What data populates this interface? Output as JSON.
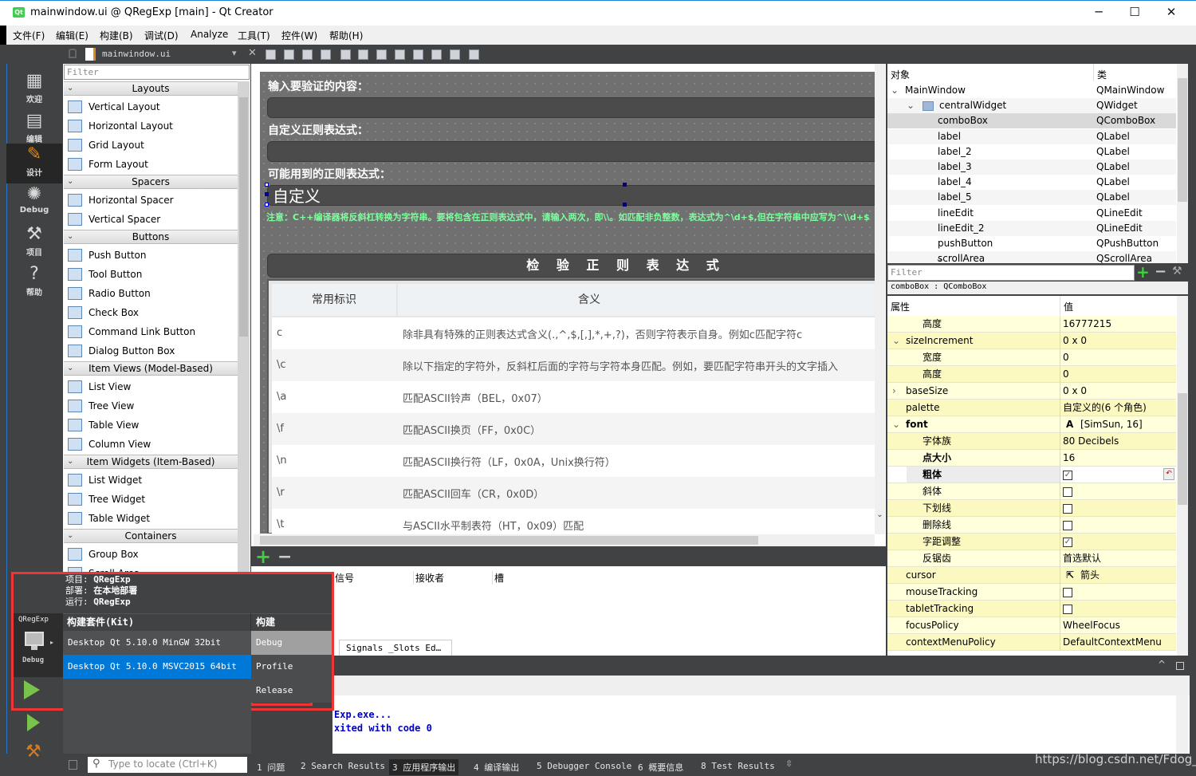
{
  "window": {
    "title": "mainwindow.ui @ QRegExp [main] - Qt Creator",
    "logo": "Qt",
    "minimize": "─",
    "maximize": "☐",
    "close": "✕"
  },
  "menu": [
    "文件(F)",
    "编辑(E)",
    "构建(B)",
    "调试(D)",
    "Analyze",
    "工具(T)",
    "控件(W)",
    "帮助(H)"
  ],
  "editor_toolbar": {
    "file": "mainwindow.ui",
    "dropdown": "▾",
    "close": "✕"
  },
  "modes": [
    {
      "label": "欢迎",
      "icon": "grid-icon",
      "glyph": "▦"
    },
    {
      "label": "编辑",
      "icon": "document-icon",
      "glyph": "▤"
    },
    {
      "label": "设计",
      "icon": "pencil-icon",
      "glyph": "✎",
      "selected": true
    },
    {
      "label": "Debug",
      "icon": "bug-icon",
      "glyph": "✺"
    },
    {
      "label": "项目",
      "icon": "wrench-icon",
      "glyph": "⚒"
    },
    {
      "label": "帮助",
      "icon": "help-icon",
      "glyph": "?"
    }
  ],
  "widget_box": {
    "filter_placeholder": "Filter",
    "sections": [
      {
        "title": "Layouts",
        "items": [
          "Vertical Layout",
          "Horizontal Layout",
          "Grid Layout",
          "Form Layout"
        ]
      },
      {
        "title": "Spacers",
        "items": [
          "Horizontal Spacer",
          "Vertical Spacer"
        ]
      },
      {
        "title": "Buttons",
        "items": [
          "Push Button",
          "Tool Button",
          "Radio Button",
          "Check Box",
          "Command Link Button",
          "Dialog Button Box"
        ]
      },
      {
        "title": "Item Views (Model-Based)",
        "items": [
          "List View",
          "Tree View",
          "Table View",
          "Column View"
        ]
      },
      {
        "title": "Item Widgets (Item-Based)",
        "items": [
          "List Widget",
          "Tree Widget",
          "Table Widget"
        ]
      },
      {
        "title": "Containers",
        "items": [
          "Group Box",
          "Scroll Area"
        ]
      }
    ]
  },
  "form": {
    "label_input": "输入要验证的内容：",
    "label_custom": "自定义正则表达式：",
    "label_possible": "可能用到的正则表达式：",
    "combo_value": "自定义",
    "note": "注意：C++编译器将反斜杠转换为字符串。要将包含在正则表达式中，请输入两次，即\\\\。如匹配非负整数，表达式为^\\d+$,但在字符串中应写为^\\\\d+$",
    "check_button": "检 验 正 则 表 达 式",
    "table": {
      "headers": [
        "常用标识",
        "含义"
      ],
      "rows": [
        [
          "c",
          "除非具有特殊的正则表达式含义(.,^,$,[,],*,+,?)，否则字符表示自身。例如c匹配字符c"
        ],
        [
          "\\c",
          "除以下指定的字符外，反斜杠后面的字符与字符本身匹配。例如，要匹配字符串开头的文字插入"
        ],
        [
          "\\a",
          "匹配ASCII铃声（BEL，0x07）"
        ],
        [
          "\\f",
          "匹配ASCII换页（FF，0x0C）"
        ],
        [
          "\\n",
          "匹配ASCII换行符（LF，0x0A，Unix换行符）"
        ],
        [
          "\\r",
          "匹配ASCII回车（CR，0x0D）"
        ],
        [
          "\\t",
          "与ASCII水平制表符（HT，0x09）匹配"
        ]
      ]
    }
  },
  "signal_slot": {
    "headers": [
      "信号",
      "接收者",
      "槽"
    ],
    "tab": "Signals _Slots Ed…",
    "add": "+",
    "remove": "−"
  },
  "object_inspector": {
    "headers": [
      "对象",
      "类"
    ],
    "rows": [
      {
        "name": "MainWindow",
        "class": "QMainWindow",
        "level": 0,
        "expand": "⌄"
      },
      {
        "name": "centralWidget",
        "class": "QWidget",
        "level": 1,
        "expand": "⌄"
      },
      {
        "name": "comboBox",
        "class": "QComboBox",
        "level": 2,
        "selected": true
      },
      {
        "name": "label",
        "class": "QLabel",
        "level": 2
      },
      {
        "name": "label_2",
        "class": "QLabel",
        "level": 2
      },
      {
        "name": "label_3",
        "class": "QLabel",
        "level": 2
      },
      {
        "name": "label_4",
        "class": "QLabel",
        "level": 2
      },
      {
        "name": "label_5",
        "class": "QLabel",
        "level": 2
      },
      {
        "name": "lineEdit",
        "class": "QLineEdit",
        "level": 2
      },
      {
        "name": "lineEdit_2",
        "class": "QLineEdit",
        "level": 2
      },
      {
        "name": "pushButton",
        "class": "QPushButton",
        "level": 2
      },
      {
        "name": "scrollArea",
        "class": "QScrollArea",
        "level": 2,
        "expand": "⌄"
      }
    ],
    "filter_placeholder": "Filter",
    "current": "comboBox : QComboBox"
  },
  "property_editor": {
    "headers": [
      "属性",
      "值"
    ],
    "rows": [
      {
        "name": "高度",
        "value": "16777215",
        "level": 1
      },
      {
        "name": "sizeIncrement",
        "value": "0 x 0",
        "level": 0,
        "expand": "⌄"
      },
      {
        "name": "宽度",
        "value": "0",
        "level": 1
      },
      {
        "name": "高度",
        "value": "0",
        "level": 1
      },
      {
        "name": "baseSize",
        "value": "0 x 0",
        "level": 0,
        "expand": "›"
      },
      {
        "name": "palette",
        "value": "自定义的(6 个角色)",
        "level": 0
      },
      {
        "name": "font",
        "value": "[SimSun, 16]",
        "level": 0,
        "expand": "⌄",
        "bold": true,
        "value_icon": "A"
      },
      {
        "name": "字体族",
        "value": "80 Decibels",
        "level": 1
      },
      {
        "name": "点大小",
        "value": "16",
        "level": 1,
        "bold": true
      },
      {
        "name": "粗体",
        "checked": true,
        "level": 1,
        "bold": true,
        "selected": true,
        "reset": "↶"
      },
      {
        "name": "斜体",
        "checked": false,
        "level": 1
      },
      {
        "name": "下划线",
        "checked": false,
        "level": 1
      },
      {
        "name": "删除线",
        "checked": false,
        "level": 1
      },
      {
        "name": "字距调整",
        "checked": true,
        "level": 1
      },
      {
        "name": "反锯齿",
        "value": "首选默认",
        "level": 1
      },
      {
        "name": "cursor",
        "value": "箭头",
        "level": 0,
        "value_icon": "⇱"
      },
      {
        "name": "mouseTracking",
        "checked": false,
        "level": 0
      },
      {
        "name": "tabletTracking",
        "checked": false,
        "level": 0
      },
      {
        "name": "focusPolicy",
        "value": "WheelFocus",
        "level": 0
      },
      {
        "name": "contextMenuPolicy",
        "value": "DefaultContextMenu",
        "level": 0
      }
    ]
  },
  "output": {
    "lines": [
      "Exp.exe...",
      "xited with code 0"
    ]
  },
  "status_bar": {
    "locate_placeholder": "Type to locate (Ctrl+K)",
    "tabs": [
      {
        "label": "1 问题"
      },
      {
        "label": "2 Search Results"
      },
      {
        "label": "3 应用程序输出",
        "active": true
      },
      {
        "label": "4 编译输出"
      },
      {
        "label": "5 Debugger Console"
      },
      {
        "label": "6 概要信息"
      },
      {
        "label": "8 Test Results"
      }
    ]
  },
  "kit_popup": {
    "project_label": "项目:",
    "project": "QRegExp",
    "deploy_label": "部署:",
    "deploy": "在本地部署",
    "run_label": "运行:",
    "run": "QRegExp",
    "kit_header": "构建套件(Kit)",
    "build_header": "构建",
    "kits": [
      {
        "label": "Desktop Qt 5.10.0 MinGW 32bit"
      },
      {
        "label": "Desktop Qt 5.10.0 MSVC2015 64bit",
        "selected": true
      }
    ],
    "builds": [
      {
        "label": "Debug",
        "current": true
      },
      {
        "label": "Profile"
      },
      {
        "label": "Release",
        "highlighted": true
      }
    ],
    "selector_project": "QRegExp",
    "selector_build": "Debug"
  },
  "watermark": "https://blog.csdn.net/Fdog_",
  "colors": {
    "accent": "#0078d7",
    "highlight_box": "#ee3434",
    "note_text": "#7dff9e",
    "property_row": "#ffffdc",
    "property_row_alt": "#fbf8c0"
  }
}
